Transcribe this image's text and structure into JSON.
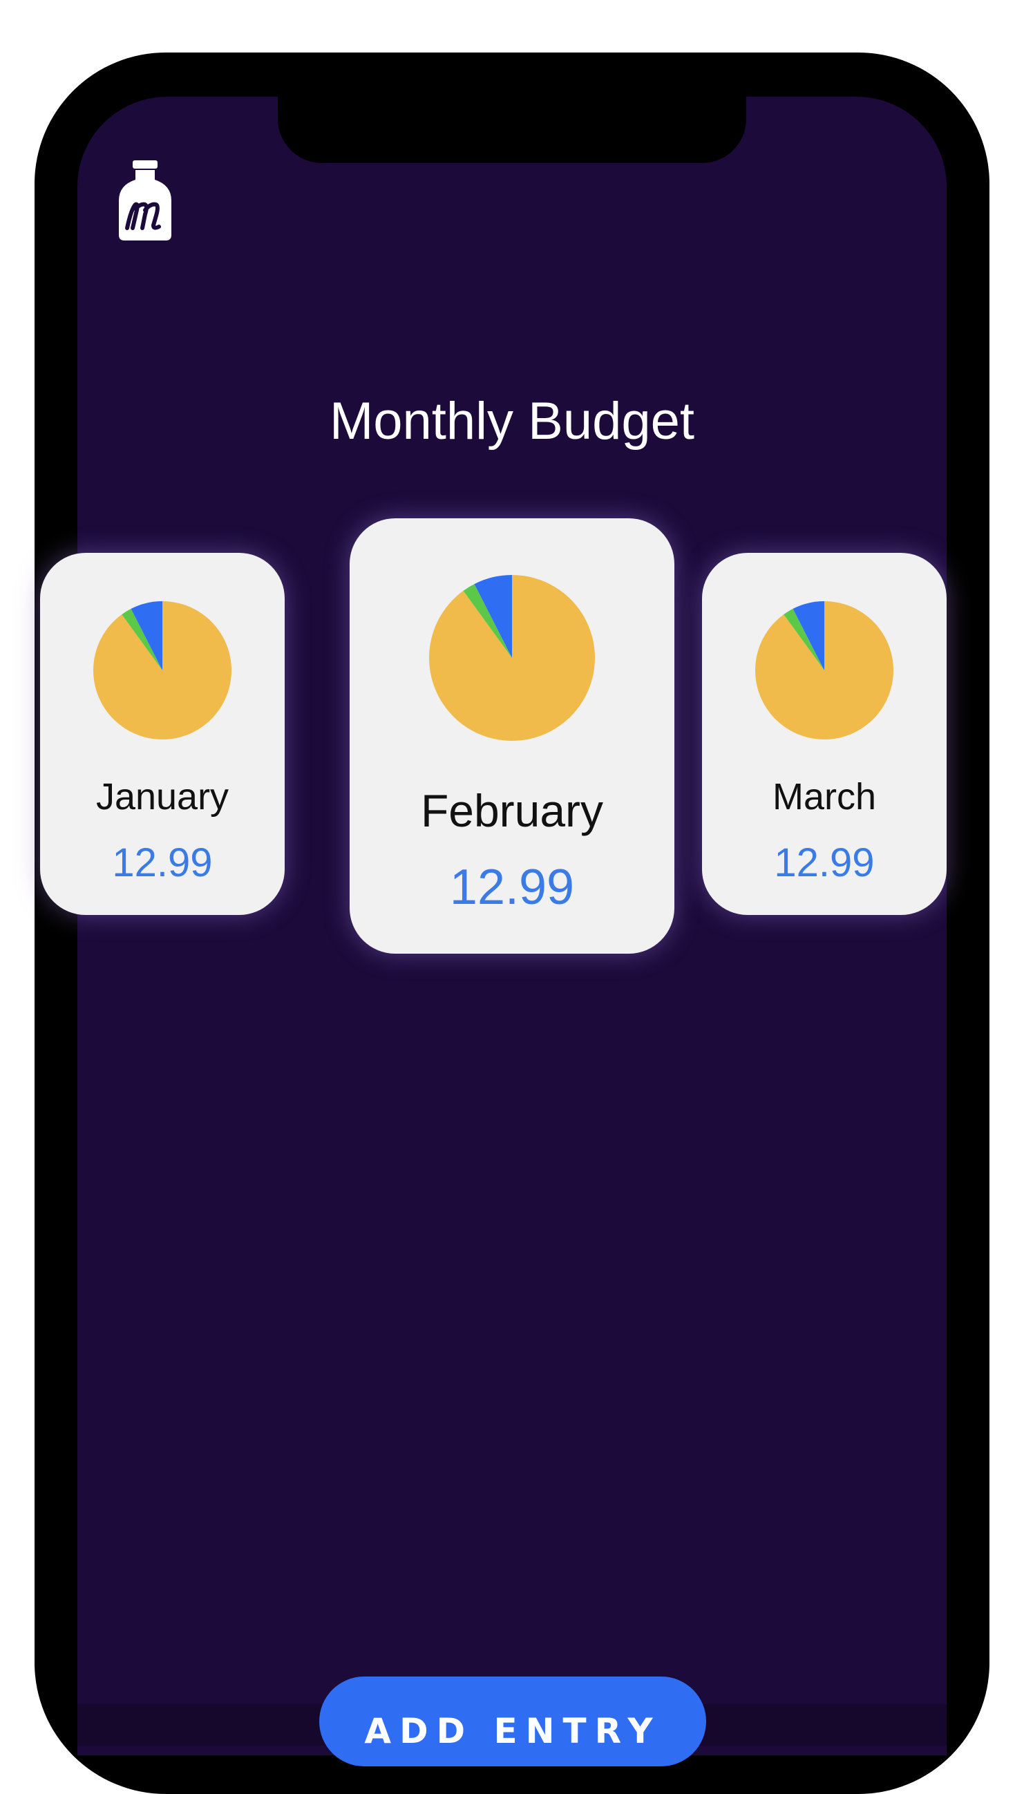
{
  "header": {
    "logo_icon": "jar-m-logo-icon",
    "title": "Monthly Budget"
  },
  "months": [
    {
      "name": "January",
      "amount": "12.99",
      "chart_data": {
        "type": "pie",
        "slices": [
          {
            "value": 0.9,
            "color": "#f0bb4b"
          },
          {
            "value": 0.025,
            "color": "#5cc84a"
          },
          {
            "value": 0.075,
            "color": "#2f6ef2"
          }
        ]
      }
    },
    {
      "name": "February",
      "amount": "12.99",
      "chart_data": {
        "type": "pie",
        "slices": [
          {
            "value": 0.9,
            "color": "#f0bb4b"
          },
          {
            "value": 0.025,
            "color": "#5cc84a"
          },
          {
            "value": 0.075,
            "color": "#2f6ef2"
          }
        ]
      }
    },
    {
      "name": "March",
      "amount": "12.99",
      "chart_data": {
        "type": "pie",
        "slices": [
          {
            "value": 0.9,
            "color": "#f0bb4b"
          },
          {
            "value": 0.025,
            "color": "#5cc84a"
          },
          {
            "value": 0.075,
            "color": "#2f6ef2"
          }
        ]
      }
    }
  ],
  "footer": {
    "add_entry_label": "ADD ENTRY"
  },
  "colors": {
    "background": "#1b0a3a",
    "card": "#f1f1f2",
    "accent": "#2f6ef2",
    "amount_text": "#3a7be6"
  }
}
